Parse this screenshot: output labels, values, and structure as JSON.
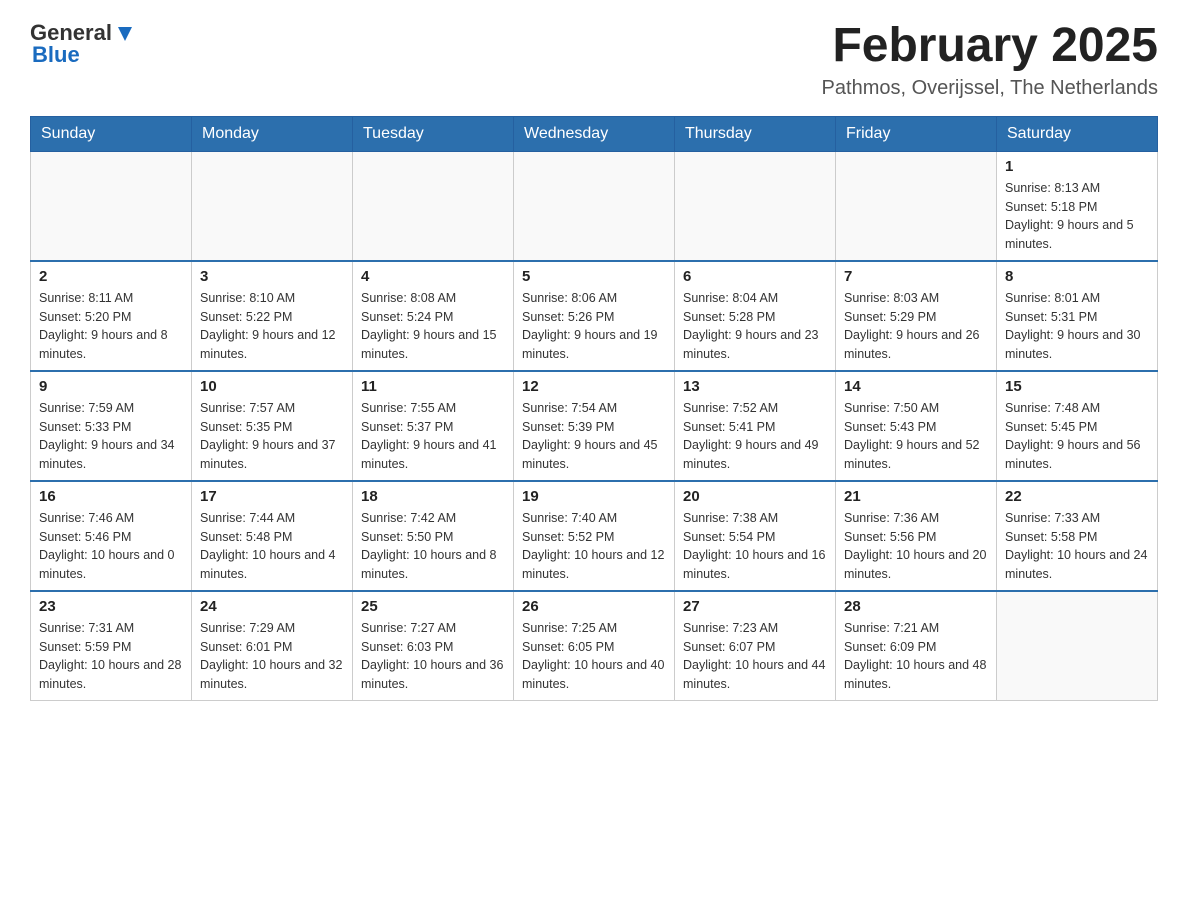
{
  "logo": {
    "text_general": "General",
    "text_blue": "Blue"
  },
  "header": {
    "title": "February 2025",
    "subtitle": "Pathmos, Overijssel, The Netherlands"
  },
  "days_of_week": [
    "Sunday",
    "Monday",
    "Tuesday",
    "Wednesday",
    "Thursday",
    "Friday",
    "Saturday"
  ],
  "weeks": [
    [
      {
        "day": "",
        "info": ""
      },
      {
        "day": "",
        "info": ""
      },
      {
        "day": "",
        "info": ""
      },
      {
        "day": "",
        "info": ""
      },
      {
        "day": "",
        "info": ""
      },
      {
        "day": "",
        "info": ""
      },
      {
        "day": "1",
        "info": "Sunrise: 8:13 AM\nSunset: 5:18 PM\nDaylight: 9 hours and 5 minutes."
      }
    ],
    [
      {
        "day": "2",
        "info": "Sunrise: 8:11 AM\nSunset: 5:20 PM\nDaylight: 9 hours and 8 minutes."
      },
      {
        "day": "3",
        "info": "Sunrise: 8:10 AM\nSunset: 5:22 PM\nDaylight: 9 hours and 12 minutes."
      },
      {
        "day": "4",
        "info": "Sunrise: 8:08 AM\nSunset: 5:24 PM\nDaylight: 9 hours and 15 minutes."
      },
      {
        "day": "5",
        "info": "Sunrise: 8:06 AM\nSunset: 5:26 PM\nDaylight: 9 hours and 19 minutes."
      },
      {
        "day": "6",
        "info": "Sunrise: 8:04 AM\nSunset: 5:28 PM\nDaylight: 9 hours and 23 minutes."
      },
      {
        "day": "7",
        "info": "Sunrise: 8:03 AM\nSunset: 5:29 PM\nDaylight: 9 hours and 26 minutes."
      },
      {
        "day": "8",
        "info": "Sunrise: 8:01 AM\nSunset: 5:31 PM\nDaylight: 9 hours and 30 minutes."
      }
    ],
    [
      {
        "day": "9",
        "info": "Sunrise: 7:59 AM\nSunset: 5:33 PM\nDaylight: 9 hours and 34 minutes."
      },
      {
        "day": "10",
        "info": "Sunrise: 7:57 AM\nSunset: 5:35 PM\nDaylight: 9 hours and 37 minutes."
      },
      {
        "day": "11",
        "info": "Sunrise: 7:55 AM\nSunset: 5:37 PM\nDaylight: 9 hours and 41 minutes."
      },
      {
        "day": "12",
        "info": "Sunrise: 7:54 AM\nSunset: 5:39 PM\nDaylight: 9 hours and 45 minutes."
      },
      {
        "day": "13",
        "info": "Sunrise: 7:52 AM\nSunset: 5:41 PM\nDaylight: 9 hours and 49 minutes."
      },
      {
        "day": "14",
        "info": "Sunrise: 7:50 AM\nSunset: 5:43 PM\nDaylight: 9 hours and 52 minutes."
      },
      {
        "day": "15",
        "info": "Sunrise: 7:48 AM\nSunset: 5:45 PM\nDaylight: 9 hours and 56 minutes."
      }
    ],
    [
      {
        "day": "16",
        "info": "Sunrise: 7:46 AM\nSunset: 5:46 PM\nDaylight: 10 hours and 0 minutes."
      },
      {
        "day": "17",
        "info": "Sunrise: 7:44 AM\nSunset: 5:48 PM\nDaylight: 10 hours and 4 minutes."
      },
      {
        "day": "18",
        "info": "Sunrise: 7:42 AM\nSunset: 5:50 PM\nDaylight: 10 hours and 8 minutes."
      },
      {
        "day": "19",
        "info": "Sunrise: 7:40 AM\nSunset: 5:52 PM\nDaylight: 10 hours and 12 minutes."
      },
      {
        "day": "20",
        "info": "Sunrise: 7:38 AM\nSunset: 5:54 PM\nDaylight: 10 hours and 16 minutes."
      },
      {
        "day": "21",
        "info": "Sunrise: 7:36 AM\nSunset: 5:56 PM\nDaylight: 10 hours and 20 minutes."
      },
      {
        "day": "22",
        "info": "Sunrise: 7:33 AM\nSunset: 5:58 PM\nDaylight: 10 hours and 24 minutes."
      }
    ],
    [
      {
        "day": "23",
        "info": "Sunrise: 7:31 AM\nSunset: 5:59 PM\nDaylight: 10 hours and 28 minutes."
      },
      {
        "day": "24",
        "info": "Sunrise: 7:29 AM\nSunset: 6:01 PM\nDaylight: 10 hours and 32 minutes."
      },
      {
        "day": "25",
        "info": "Sunrise: 7:27 AM\nSunset: 6:03 PM\nDaylight: 10 hours and 36 minutes."
      },
      {
        "day": "26",
        "info": "Sunrise: 7:25 AM\nSunset: 6:05 PM\nDaylight: 10 hours and 40 minutes."
      },
      {
        "day": "27",
        "info": "Sunrise: 7:23 AM\nSunset: 6:07 PM\nDaylight: 10 hours and 44 minutes."
      },
      {
        "day": "28",
        "info": "Sunrise: 7:21 AM\nSunset: 6:09 PM\nDaylight: 10 hours and 48 minutes."
      },
      {
        "day": "",
        "info": ""
      }
    ]
  ]
}
